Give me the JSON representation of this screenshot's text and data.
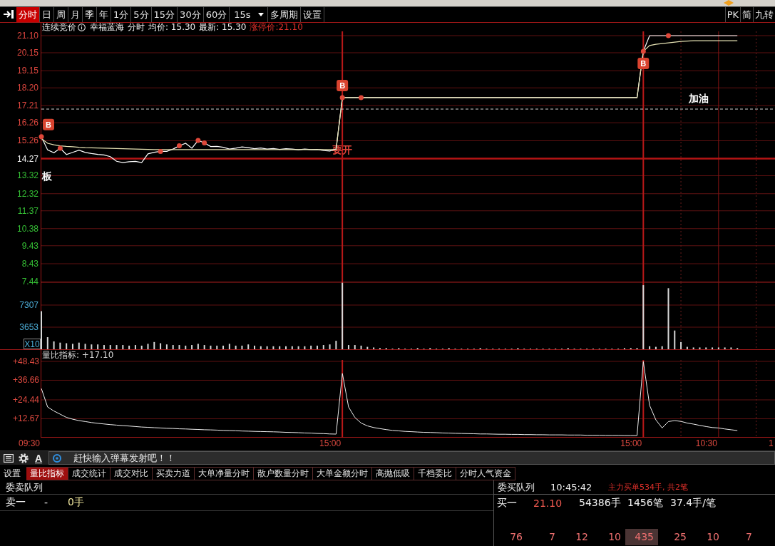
{
  "period_bar": {
    "tabs": [
      {
        "label": "分时",
        "selected": true
      },
      {
        "label": "日",
        "selected": false
      },
      {
        "label": "周",
        "selected": false
      },
      {
        "label": "月",
        "selected": false
      },
      {
        "label": "季",
        "selected": false
      },
      {
        "label": "年",
        "selected": false
      },
      {
        "label": "1分",
        "selected": false
      },
      {
        "label": "5分",
        "selected": false
      },
      {
        "label": "15分",
        "selected": false
      },
      {
        "label": "30分",
        "selected": false
      },
      {
        "label": "60分",
        "selected": false
      }
    ],
    "interval": "15s",
    "buttons": [
      "多周期",
      "设置"
    ],
    "right_buttons": [
      "PK",
      "简",
      "九转"
    ]
  },
  "info_bar": {
    "status": "连续竞价",
    "items": [
      "幸福蓝海",
      "分时",
      "均价: 15.30",
      "最新: 15.30"
    ],
    "limit_price": "涨停价:21.10"
  },
  "price_chart": {
    "comments": [
      {
        "text": "板",
        "color": "#ffffff"
      },
      {
        "text": "要开",
        "color": "#e0453a"
      },
      {
        "text": "加油",
        "color": "#ffffff"
      }
    ],
    "chart_data": {
      "type": "line",
      "grid": true,
      "categories": [
        null,
        null,
        null,
        null,
        null,
        null,
        null,
        null,
        null,
        null,
        null,
        null,
        null,
        null,
        null,
        null,
        null,
        null,
        null,
        null,
        null,
        null,
        null,
        null,
        null,
        null,
        null,
        null,
        null,
        null,
        null,
        null,
        null,
        null,
        null,
        null,
        null,
        null,
        null,
        null,
        null,
        null,
        null,
        null,
        null,
        null,
        null,
        null,
        null,
        null,
        null,
        null,
        null,
        null,
        null,
        null,
        null,
        null,
        null,
        null,
        null,
        null,
        null,
        null,
        null,
        null,
        null,
        null,
        null,
        null,
        null,
        null,
        null,
        null,
        null,
        null,
        null,
        null,
        null,
        null,
        null,
        null,
        null,
        null,
        null,
        null,
        null,
        null,
        null,
        null,
        null,
        null,
        null,
        null,
        null,
        null,
        null,
        null,
        null,
        null,
        null,
        null,
        null,
        null,
        null,
        null,
        null,
        null,
        null,
        null,
        null,
        null,
        null,
        null,
        null,
        null,
        null
      ],
      "series": [
        {
          "color": "#ffffff",
          "values": [
            15.49,
            14.75,
            14.6,
            14.84,
            14.5,
            14.62,
            14.74,
            14.61,
            14.55,
            14.5,
            14.47,
            14.38,
            14.12,
            14.05,
            14.1,
            14.12,
            14.05,
            14.53,
            14.62,
            14.67,
            14.67,
            14.8,
            14.98,
            15.12,
            14.85,
            15.28,
            15.14,
            14.94,
            14.95,
            14.9,
            14.8,
            14.85,
            14.92,
            14.88,
            14.82,
            14.86,
            14.8,
            14.83,
            14.78,
            14.82,
            14.8,
            14.76,
            14.8,
            14.77,
            14.78,
            14.72,
            14.69,
            14.8,
            17.66,
            17.66,
            17.66,
            17.66,
            17.66,
            17.66,
            17.66,
            17.66,
            17.66,
            17.66,
            17.66,
            17.66,
            17.66,
            17.66,
            17.66,
            17.66,
            17.66,
            17.66,
            17.66,
            17.66,
            17.66,
            17.66,
            17.66,
            17.66,
            17.66,
            17.66,
            17.66,
            17.66,
            17.66,
            17.66,
            17.66,
            17.66,
            17.66,
            17.66,
            17.66,
            17.66,
            17.66,
            17.66,
            17.66,
            17.66,
            17.66,
            17.66,
            17.66,
            17.66,
            17.66,
            17.66,
            17.66,
            17.66,
            20.23,
            21.1,
            21.1,
            21.1,
            21.1,
            21.1,
            21.1,
            21.1,
            21.1,
            21.1,
            21.1,
            21.1,
            21.1,
            21.1,
            21.1,
            21.1,
            null,
            null,
            null,
            null,
            null
          ]
        },
        {
          "color": "#e6e2b4",
          "values": [
            15.38,
            15.12,
            15.04,
            14.98,
            14.95,
            14.93,
            14.9,
            14.88,
            14.87,
            14.86,
            14.85,
            14.84,
            14.83,
            14.82,
            14.81,
            14.8,
            14.79,
            14.78,
            14.77,
            14.77,
            14.77,
            14.77,
            14.77,
            14.77,
            14.77,
            14.77,
            14.77,
            14.77,
            14.77,
            14.77,
            14.77,
            14.77,
            14.77,
            14.77,
            14.77,
            14.77,
            14.77,
            14.77,
            14.77,
            14.77,
            14.77,
            14.77,
            14.77,
            14.77,
            14.77,
            14.77,
            14.77,
            14.77,
            17.66,
            17.66,
            17.66,
            17.66,
            17.66,
            17.66,
            17.66,
            17.66,
            17.66,
            17.66,
            17.66,
            17.66,
            17.66,
            17.66,
            17.66,
            17.66,
            17.66,
            17.66,
            17.66,
            17.66,
            17.66,
            17.66,
            17.66,
            17.66,
            17.66,
            17.66,
            17.66,
            17.66,
            17.66,
            17.66,
            17.66,
            17.66,
            17.66,
            17.66,
            17.66,
            17.66,
            17.66,
            17.66,
            17.66,
            17.66,
            17.66,
            17.66,
            17.66,
            17.66,
            17.66,
            17.66,
            17.66,
            17.66,
            20.23,
            20.55,
            20.62,
            20.66,
            20.7,
            20.74,
            20.78,
            20.8,
            20.82,
            20.82,
            20.82,
            20.82,
            20.82,
            20.82,
            20.82,
            20.82,
            null,
            null,
            null,
            null,
            null
          ]
        }
      ],
      "ylim": [
        7.44,
        21.1
      ],
      "yticks": [
        {
          "value": 21.1,
          "label": "21.10"
        },
        {
          "value": 20.15,
          "label": "20.15"
        },
        {
          "value": 19.15,
          "label": "19.15"
        },
        {
          "value": 18.2,
          "label": "18.20"
        },
        {
          "value": 17.21,
          "label": "17.21"
        },
        {
          "value": 16.26,
          "label": "16.26"
        },
        {
          "value": 15.26,
          "label": "15.26"
        },
        {
          "value": 14.27,
          "label": "14.27"
        },
        {
          "value": 13.32,
          "label": "13.32"
        },
        {
          "value": 12.32,
          "label": "12.32"
        },
        {
          "value": 11.37,
          "label": "11.37"
        },
        {
          "value": 10.38,
          "label": "10.38"
        },
        {
          "value": 9.43,
          "label": "9.43"
        },
        {
          "value": 8.43,
          "label": "8.43"
        },
        {
          "value": 7.44,
          "label": "7.44"
        }
      ],
      "ref_lines": [
        {
          "axis": "y",
          "value": 14.27
        },
        {
          "axis": "y",
          "value": 17.02
        }
      ],
      "annotations": [
        "B",
        "B",
        "B"
      ]
    }
  },
  "volume_chart": {
    "chart_data": {
      "type": "bar",
      "grid": true,
      "categories": [
        null,
        null,
        null,
        null,
        null,
        null,
        null,
        null,
        null,
        null,
        null,
        null,
        null,
        null,
        null,
        null,
        null,
        null,
        null,
        null,
        null,
        null,
        null,
        null,
        null,
        null,
        null,
        null,
        null,
        null,
        null,
        null,
        null,
        null,
        null,
        null,
        null,
        null,
        null,
        null,
        null,
        null,
        null,
        null,
        null,
        null,
        null,
        null,
        null,
        null,
        null,
        null,
        null,
        null,
        null,
        null,
        null,
        null,
        null,
        null,
        null,
        null,
        null,
        null,
        null,
        null,
        null,
        null,
        null,
        null,
        null,
        null,
        null,
        null,
        null,
        null,
        null,
        null,
        null,
        null,
        null,
        null,
        null,
        null,
        null,
        null,
        null,
        null,
        null,
        null,
        null,
        null,
        null,
        null,
        null,
        null,
        null,
        null,
        null,
        null,
        null,
        null,
        null,
        null,
        null,
        null,
        null,
        null,
        null,
        null,
        null,
        null,
        null,
        null,
        null,
        null,
        null
      ],
      "series": [
        {
          "color": "#d8d8d8",
          "values": [
            6300,
            2000,
            1300,
            1100,
            1000,
            900,
            1100,
            900,
            800,
            800,
            700,
            700,
            700,
            700,
            600,
            700,
            600,
            900,
            1200,
            1000,
            800,
            700,
            700,
            600,
            700,
            900,
            700,
            600,
            600,
            600,
            900,
            600,
            600,
            800,
            600,
            500,
            500,
            500,
            500,
            500,
            500,
            500,
            500,
            600,
            600,
            700,
            800,
            1400,
            11000,
            700,
            700,
            600,
            400,
            300,
            200,
            200,
            100,
            200,
            100,
            100,
            200,
            100,
            200,
            100,
            100,
            200,
            100,
            100,
            100,
            100,
            200,
            100,
            100,
            100,
            100,
            100,
            200,
            100,
            100,
            100,
            100,
            100,
            100,
            100,
            200,
            100,
            100,
            100,
            100,
            100,
            100,
            100,
            100,
            200,
            200,
            200,
            10600,
            500,
            400,
            500,
            10100,
            3100,
            1200,
            400,
            300,
            300,
            300,
            300,
            300,
            300,
            300,
            200,
            null,
            null,
            null,
            null,
            null
          ]
        }
      ],
      "ylim": [
        0,
        11080
      ],
      "yticks": [
        3653,
        7307
      ],
      "ylabel": "X10"
    }
  },
  "indicator": {
    "time_axis": [
      "09:30",
      "15:00",
      "15:00",
      "10:30",
      "1"
    ],
    "chart_data": {
      "type": "line",
      "grid": true,
      "title": "量比指标: +17.10",
      "categories": [
        null,
        null,
        null,
        null,
        null,
        null,
        null,
        null,
        null,
        null,
        null,
        null,
        null,
        null,
        null,
        null,
        null,
        null,
        null,
        null,
        null,
        null,
        null,
        null,
        null,
        null,
        null,
        null,
        null,
        null,
        null,
        null,
        null,
        null,
        null,
        null,
        null,
        null,
        null,
        null,
        null,
        null,
        null,
        null,
        null,
        null,
        null,
        null,
        null,
        null,
        null,
        null,
        null,
        null,
        null,
        null,
        null,
        null,
        null,
        null,
        null,
        null,
        null,
        null,
        null,
        null,
        null,
        null,
        null,
        null,
        null,
        null,
        null,
        null,
        null,
        null,
        null,
        null,
        null,
        null,
        null,
        null,
        null,
        null,
        null,
        null,
        null,
        null,
        null,
        null,
        null,
        null,
        null,
        null,
        null,
        null,
        null,
        null,
        null,
        null,
        null,
        null,
        null,
        null,
        null,
        null,
        null,
        null,
        null,
        null,
        null,
        null,
        null,
        null,
        null,
        null,
        null
      ],
      "series": [
        {
          "color": "#f0f0f0",
          "values": [
            31.5,
            20,
            17.5,
            15.5,
            13.5,
            12.4,
            11.5,
            10.9,
            10.3,
            9.8,
            9.4,
            9,
            8.7,
            8.4,
            8.1,
            7.8,
            7.5,
            7.3,
            7.1,
            6.9,
            6.7,
            6.6,
            6.4,
            6.3,
            6.1,
            6,
            5.8,
            5.7,
            5.6,
            5.4,
            5.3,
            5.2,
            5,
            4.9,
            4.8,
            4.7,
            4.6,
            4.5,
            4.4,
            4.2,
            4.1,
            4,
            3.8,
            3.7,
            3.5,
            3.4,
            3.2,
            3.1,
            40.9,
            20,
            13.5,
            10,
            8.2,
            7.2,
            6.5,
            5.9,
            5.4,
            5.1,
            4.8,
            4.6,
            4.4,
            4.2,
            4.1,
            4,
            3.8,
            3.7,
            3.6,
            3.5,
            3.4,
            3.3,
            3.2,
            3.2,
            3.1,
            3,
            3,
            2.9,
            2.9,
            2.8,
            2.8,
            2.7,
            2.7,
            2.6,
            2.6,
            2.6,
            2.5,
            2.5,
            2.5,
            2.4,
            2.4,
            2.4,
            2.3,
            2.3,
            2.3,
            2.2,
            2.2,
            2.2,
            48.4,
            21,
            12,
            6.9,
            10.9,
            11.5,
            11,
            10,
            9.3,
            8.5,
            7.8,
            7.2,
            6.9,
            6.3,
            5.8,
            5.3,
            null,
            null,
            null,
            null,
            null
          ]
        }
      ],
      "ylim": [
        1.32,
        48.43
      ],
      "yticks": [
        {
          "value": 12.67,
          "label": "+12.67"
        },
        {
          "value": 24.44,
          "label": "+24.44"
        },
        {
          "value": 36.66,
          "label": "+36.66"
        },
        {
          "value": 48.43,
          "label": "+48.43"
        }
      ]
    }
  },
  "danmaku_bar": {
    "font_button": "A",
    "placeholder": "赶快输入弹幕发射吧！！"
  },
  "bottom_bar": {
    "settings": "设置",
    "tabs": [
      {
        "label": "量比指标",
        "selected": true
      },
      {
        "label": "成交统计",
        "selected": false
      },
      {
        "label": "成交对比",
        "selected": false
      },
      {
        "label": "买卖力道",
        "selected": false
      },
      {
        "label": "大单净量分时",
        "selected": false
      },
      {
        "label": "散户数量分时",
        "selected": false
      },
      {
        "label": "大单金额分时",
        "selected": false
      },
      {
        "label": "高抛低吸",
        "selected": false
      },
      {
        "label": "千档委比",
        "selected": false
      },
      {
        "label": "分时人气资金",
        "selected": false
      }
    ]
  },
  "sell_queue": {
    "title": "委卖队列",
    "rows": [
      {
        "label": "卖一",
        "price": "-",
        "volume": "0手"
      }
    ]
  },
  "buy_queue": {
    "title": "委买队列",
    "time": "10:45:42",
    "note": "主力买单534手, 共2笔",
    "rows": [
      {
        "label": "买一",
        "price": "21.10",
        "volume": "54386手",
        "count": "1456笔",
        "average": "37.4手/笔"
      }
    ],
    "orders": [
      {
        "value": "76",
        "highlighted": false
      },
      {
        "value": "7",
        "highlighted": false
      },
      {
        "value": "12",
        "highlighted": false
      },
      {
        "value": "10",
        "highlighted": false
      },
      {
        "value": "435",
        "highlighted": true
      },
      {
        "value": "25",
        "highlighted": false
      },
      {
        "value": "10",
        "highlighted": false
      },
      {
        "value": "7",
        "highlighted": false
      }
    ]
  }
}
